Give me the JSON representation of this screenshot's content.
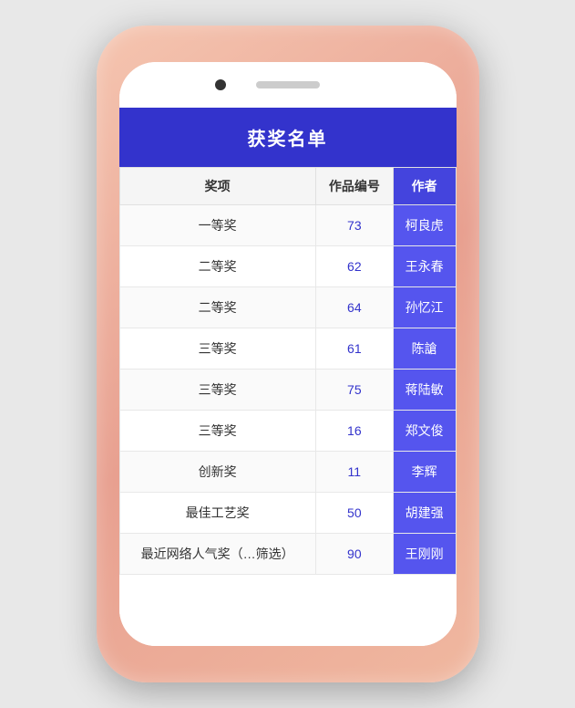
{
  "phone": {
    "table": {
      "title": "获奖名单",
      "columns": [
        "奖项",
        "作品编号",
        "作者"
      ],
      "rows": [
        {
          "award": "一等奖",
          "work_id": "73",
          "author": "柯良虎"
        },
        {
          "award": "二等奖",
          "work_id": "62",
          "author": "王永春"
        },
        {
          "award": "二等奖",
          "work_id": "64",
          "author": "孙忆江"
        },
        {
          "award": "三等奖",
          "work_id": "61",
          "author": "陈謒"
        },
        {
          "award": "三等奖",
          "work_id": "75",
          "author": "蒋陆敏"
        },
        {
          "award": "三等奖",
          "work_id": "16",
          "author": "郑文俊"
        },
        {
          "award": "创新奖",
          "work_id": "11",
          "author": "李辉"
        },
        {
          "award": "最佳工艺奖",
          "work_id": "50",
          "author": "胡建强"
        },
        {
          "award": "最近网络人气奖（…筛选）",
          "work_id": "90",
          "author": "王刚刚"
        }
      ]
    }
  },
  "colors": {
    "header_bg": "#3333cc",
    "author_col_bg": "#5555ee",
    "author_header_bg": "#4444dd"
  }
}
